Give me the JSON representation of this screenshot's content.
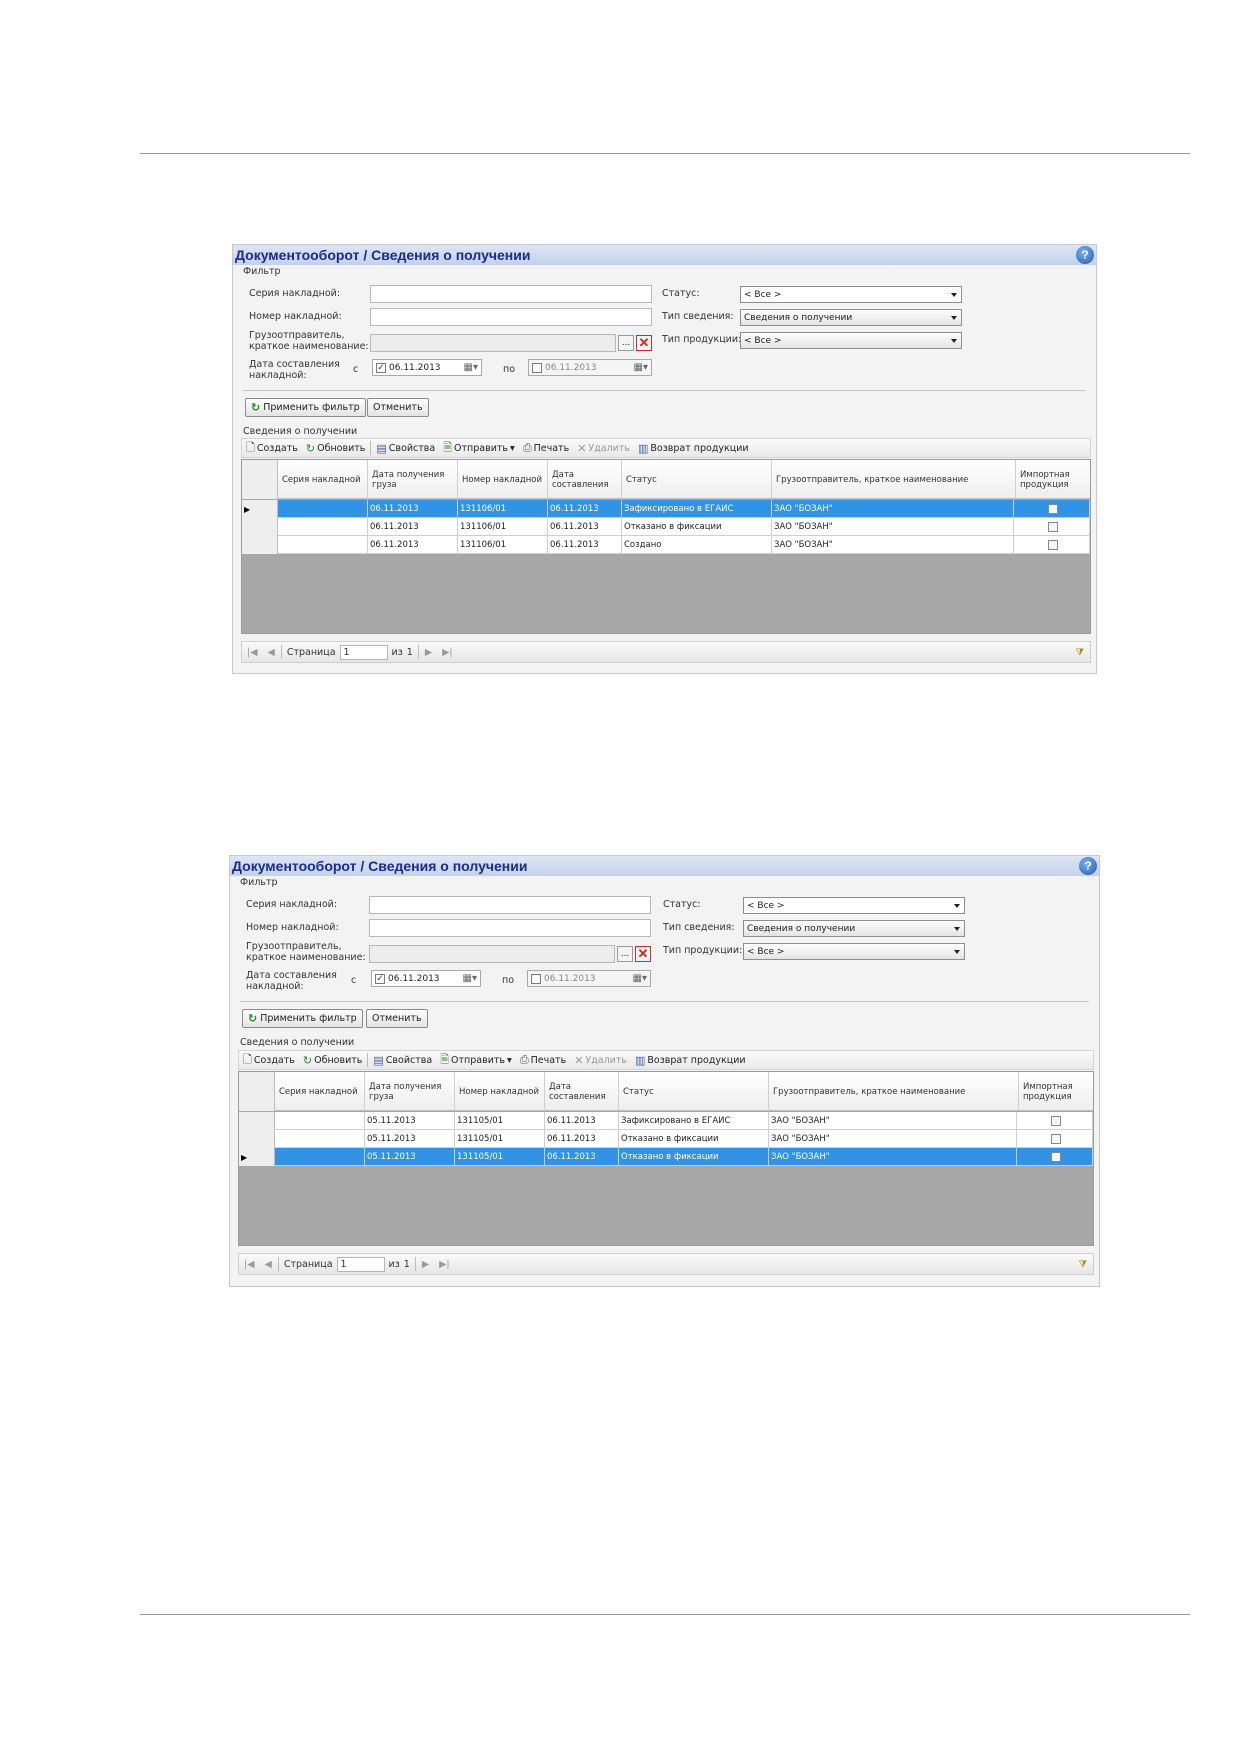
{
  "panels": [
    {
      "title": "Документооборот / Сведения о получении",
      "filter": {
        "group_label": "Фильтр",
        "series_label": "Серия накладной:",
        "number_label": "Номер накладной:",
        "shipper_label_1": "Грузоотправитель,",
        "shipper_label_2": "краткое наименование:",
        "date_label_1": "Дата составления",
        "date_label_2": "накладной:",
        "from_label": "с",
        "to_label": "по",
        "date_from": "06.11.2013",
        "date_from_checked": "✓",
        "date_to": "06.11.2013",
        "status_label": "Статус:",
        "status_value": "< Все >",
        "info_type_label": "Тип сведения:",
        "info_type_value": "Сведения о получении",
        "product_type_label": "Тип продукции:",
        "product_type_value": "< Все >",
        "browse_label": "...",
        "clear_label": "✕",
        "apply_button": "Применить фильтр",
        "cancel_button": "Отменить"
      },
      "section_label": "Сведения о получении",
      "toolbar": {
        "create": "Создать",
        "refresh": "Обновить",
        "properties": "Свойства",
        "send": "Отправить",
        "print": "Печать",
        "delete": "Удалить",
        "return": "Возврат продукции"
      },
      "columns": [
        "Серия накладной",
        "Дата получения груза",
        "Номер накладной",
        "Дата составления",
        "Статус",
        "Грузоотправитель, краткое наименование",
        "Импортная продукция"
      ],
      "rows": [
        {
          "series": "",
          "recv_date": "06.11.2013",
          "number": "131106/01",
          "comp_date": "06.11.2013",
          "status": "Зафиксировано в ЕГАИС",
          "shipper": "ЗАО \"БОЗАН\"",
          "selected": true
        },
        {
          "series": "",
          "recv_date": "06.11.2013",
          "number": "131106/01",
          "comp_date": "06.11.2013",
          "status": "Отказано в фиксации",
          "shipper": "ЗАО \"БОЗАН\"",
          "selected": false
        },
        {
          "series": "",
          "recv_date": "06.11.2013",
          "number": "131106/01",
          "comp_date": "06.11.2013",
          "status": "Создано",
          "shipper": "ЗАО \"БОЗАН\"",
          "selected": false
        }
      ],
      "pager": {
        "page_label": "Страница",
        "page": "1",
        "of_label": "из",
        "total": "1"
      }
    },
    {
      "title": "Документооборот / Сведения о получении",
      "filter": {
        "group_label": "Фильтр",
        "series_label": "Серия накладной:",
        "number_label": "Номер накладной:",
        "shipper_label_1": "Грузоотправитель,",
        "shipper_label_2": "краткое наименование:",
        "date_label_1": "Дата составления",
        "date_label_2": "накладной:",
        "from_label": "с",
        "to_label": "по",
        "date_from": "06.11.2013",
        "date_from_checked": "✓",
        "date_to": "06.11.2013",
        "status_label": "Статус:",
        "status_value": "< Все >",
        "info_type_label": "Тип сведения:",
        "info_type_value": "Сведения о получении",
        "product_type_label": "Тип продукции:",
        "product_type_value": "< Все >",
        "browse_label": "...",
        "clear_label": "✕",
        "apply_button": "Применить фильтр",
        "cancel_button": "Отменить"
      },
      "section_label": "Сведения о получении",
      "toolbar": {
        "create": "Создать",
        "refresh": "Обновить",
        "properties": "Свойства",
        "send": "Отправить",
        "print": "Печать",
        "delete": "Удалить",
        "return": "Возврат продукции"
      },
      "columns": [
        "Серия накладной",
        "Дата получения груза",
        "Номер накладной",
        "Дата составления",
        "Статус",
        "Грузоотправитель, краткое наименование",
        "Импортная продукция"
      ],
      "rows": [
        {
          "series": "",
          "recv_date": "05.11.2013",
          "number": "131105/01",
          "comp_date": "06.11.2013",
          "status": "Зафиксировано в ЕГАИС",
          "shipper": "ЗАО \"БОЗАН\"",
          "selected": false
        },
        {
          "series": "",
          "recv_date": "05.11.2013",
          "number": "131105/01",
          "comp_date": "06.11.2013",
          "status": "Отказано в фиксации",
          "shipper": "ЗАО \"БОЗАН\"",
          "selected": false
        },
        {
          "series": "",
          "recv_date": "05.11.2013",
          "number": "131105/01",
          "comp_date": "06.11.2013",
          "status": "Отказано в фиксации",
          "shipper": "ЗАО \"БОЗАН\"",
          "selected": true
        }
      ],
      "pager": {
        "page_label": "Страница",
        "page": "1",
        "of_label": "из",
        "total": "1"
      }
    }
  ]
}
